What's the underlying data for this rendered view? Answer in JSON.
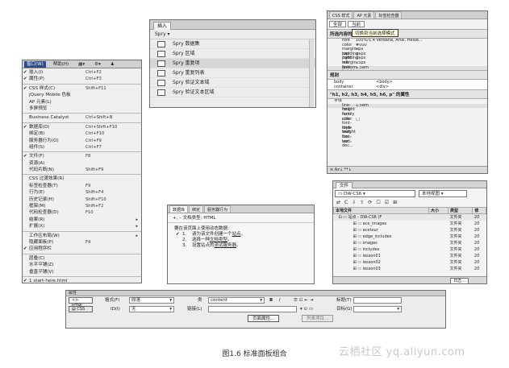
{
  "menu": {
    "bar": [
      "窗口(W)",
      "帮助(H)",
      "▦▾",
      "⚙▾",
      "♟"
    ],
    "groups": [
      [
        {
          "check": "✔",
          "label": "插入(I)",
          "shortcut": "Ctrl+F2"
        },
        {
          "check": "✔",
          "label": "属性(P)",
          "shortcut": "Ctrl+F3"
        }
      ],
      [
        {
          "check": "✔",
          "label": "CSS 样式(C)",
          "shortcut": "Shift+F11"
        },
        {
          "check": "",
          "label": "jQuery Mobile 色板",
          "shortcut": ""
        },
        {
          "check": "",
          "label": "AP 元素(L)",
          "shortcut": ""
        },
        {
          "check": "",
          "label": "多屏预览",
          "shortcut": ""
        }
      ],
      [
        {
          "check": "",
          "label": "Business Catalyst",
          "shortcut": "Ctrl+Shift+B"
        }
      ],
      [
        {
          "check": "✔",
          "label": "数据库(D)",
          "shortcut": "Ctrl+Shift+F10"
        },
        {
          "check": "",
          "label": "绑定(B)",
          "shortcut": "Ctrl+F10"
        },
        {
          "check": "",
          "label": "服务器行为(O)",
          "shortcut": "Ctrl+F9"
        },
        {
          "check": "",
          "label": "组件(S)",
          "shortcut": "Ctrl+F7"
        }
      ],
      [
        {
          "check": "✔",
          "label": "文件(F)",
          "shortcut": "F8"
        },
        {
          "check": "",
          "label": "资源(A)",
          "shortcut": ""
        },
        {
          "check": "",
          "label": "代码片断(N)",
          "shortcut": "Shift+F9"
        }
      ],
      [
        {
          "check": "",
          "label": "CSS 过渡效果(R)",
          "shortcut": ""
        },
        {
          "check": "",
          "label": "标签检查器(T)",
          "shortcut": "F9"
        },
        {
          "check": "",
          "label": "行为(E)",
          "shortcut": "Shift+F4"
        },
        {
          "check": "",
          "label": "历史记录(H)",
          "shortcut": "Shift+F10"
        },
        {
          "check": "",
          "label": "框架(M)",
          "shortcut": "Shift+F2"
        },
        {
          "check": "",
          "label": "代码检查器(D)",
          "shortcut": "F10"
        },
        {
          "check": "",
          "label": "结果(R)",
          "shortcut": "",
          "arrow": "▸"
        },
        {
          "check": "",
          "label": "扩展(X)",
          "shortcut": "",
          "arrow": "▸"
        }
      ],
      [
        {
          "check": "",
          "label": "工作区布局(W)",
          "shortcut": "",
          "arrow": "▸"
        },
        {
          "check": "",
          "label": "隐藏面板(P)",
          "shortcut": "F4"
        },
        {
          "check": "✔",
          "label": "应用程序栏",
          "shortcut": ""
        }
      ],
      [
        {
          "check": "",
          "label": "层叠(C)",
          "shortcut": ""
        },
        {
          "check": "",
          "label": "水平平铺(Z)",
          "shortcut": ""
        },
        {
          "check": "",
          "label": "垂直平铺(V)",
          "shortcut": ""
        }
      ],
      [
        {
          "check": "✔",
          "label": "1 start-here.html",
          "shortcut": ""
        }
      ]
    ]
  },
  "insert": {
    "tab": "插入",
    "category": "Spry ▾",
    "items": [
      "Spry 数据集",
      "Spry 区域",
      "Spry 重复项",
      "Spry 重复列表",
      "Spry 验证文本域",
      "Spry 验证文本区域"
    ],
    "selected_index": 2
  },
  "css": {
    "tabs": [
      "CSS 样式",
      "AP 元素",
      "标签检查器"
    ],
    "modes": [
      "全部",
      "当前"
    ],
    "section1": "所选内容的摘要",
    "tooltip": "切换到当前选择模式",
    "props": [
      {
        "k": "font",
        "v": "100%/1.4 Verdana, Arial, Helve..."
      },
      {
        "k": "color",
        "v": "#000"
      },
      {
        "k": "margin-top",
        "v": "0px"
      },
      {
        "k": "padding-right",
        "v": "15px"
      },
      {
        "k": "padding-left",
        "v": "15px"
      },
      {
        "k": "margin-bottom",
        "v": "15px"
      },
      {
        "k": "line-height",
        "v": "1.5em"
      }
    ],
    "section2": "规则",
    "rules": [
      {
        "k": "body",
        "v": "<body>"
      },
      {
        "k": "container",
        "v": "<div>"
      }
    ],
    "section3": "\"h1, h2, h3, h4, h5, h6, p\" 的属性",
    "sub": "字体",
    "props2": [
      {
        "k": "line-height",
        "v": "1.5em"
      },
      {
        "k": "font-family",
        "v": ""
      },
      {
        "k": "font-size",
        "v": ""
      },
      {
        "k": "color",
        "v": "□"
      },
      {
        "k": "font-style",
        "v": ""
      },
      {
        "k": "font-weight",
        "v": ""
      },
      {
        "k": "text-tra...",
        "v": ""
      },
      {
        "k": "font-var...",
        "v": ""
      },
      {
        "k": "text-dec...",
        "v": ""
      }
    ],
    "bottom": "≡ Az↓ **↓"
  },
  "files": {
    "tab": "文件",
    "site": "DW-CS6",
    "view": "本地视图",
    "icons": [
      "⇄",
      "C",
      "⇩",
      "⇧",
      "⟳",
      "☐",
      "☑",
      "⊞"
    ],
    "headers": [
      "本地文件",
      "大小",
      "类型",
      "修"
    ],
    "rows": [
      {
        "name": "站点 - DW-CS6 (F",
        "size": "",
        "type": "文件夹",
        "mod": "20",
        "site": true
      },
      {
        "name": "ace_images",
        "size": "",
        "type": "文件夹",
        "mod": "20"
      },
      {
        "name": "acetour",
        "size": "",
        "type": "文件夹",
        "mod": "20"
      },
      {
        "name": "edge_includes",
        "size": "",
        "type": "文件夹",
        "mod": "20"
      },
      {
        "name": "images",
        "size": "",
        "type": "文件夹",
        "mod": "20"
      },
      {
        "name": "includes",
        "size": "",
        "type": "文件夹",
        "mod": "20"
      },
      {
        "name": "lesson01",
        "size": "",
        "type": "文件夹",
        "mod": "20"
      },
      {
        "name": "lesson02",
        "size": "",
        "type": "文件夹",
        "mod": "20"
      },
      {
        "name": "lesson03",
        "size": "",
        "type": "文件夹",
        "mod": "20"
      }
    ],
    "log": "日志..."
  },
  "results": {
    "tabs": [
      "数据库",
      "绑定",
      "服务器行为"
    ],
    "doctype": "+, –  文档类型: HTML",
    "intro": "要在该页面上使用动态数据:",
    "steps": [
      {
        "n": "1.",
        "check": "✔",
        "pre": "请为该文件创建一个",
        "link": "站点",
        "post": "。"
      },
      {
        "n": "2.",
        "check": "",
        "pre": "选择一种",
        "link": "文档类型",
        "post": "。"
      },
      {
        "n": "3.",
        "check": "",
        "pre": "设置站点的",
        "link": "测试服务器",
        "post": "。"
      }
    ]
  },
  "props": {
    "title": "属性",
    "html_btn": "<> HTML",
    "css_btn": "▤ CSS",
    "format_label": "格式(F)",
    "format_value": "段落",
    "class_label": "类",
    "class_value": "content",
    "id_label": "ID(I)",
    "id_value": "无",
    "link_label": "链接(L)",
    "title_label": "标题(T)",
    "target_label": "目标(G)",
    "bold": "B",
    "italic": "I",
    "list_icons": "☰ ☷ ⇤ ⇥",
    "page_props": "页面属性...",
    "list_item": "列表项目..."
  },
  "caption": "图1.6   标准面板组合",
  "watermark": "云栖社区 yq.aliyun.com"
}
